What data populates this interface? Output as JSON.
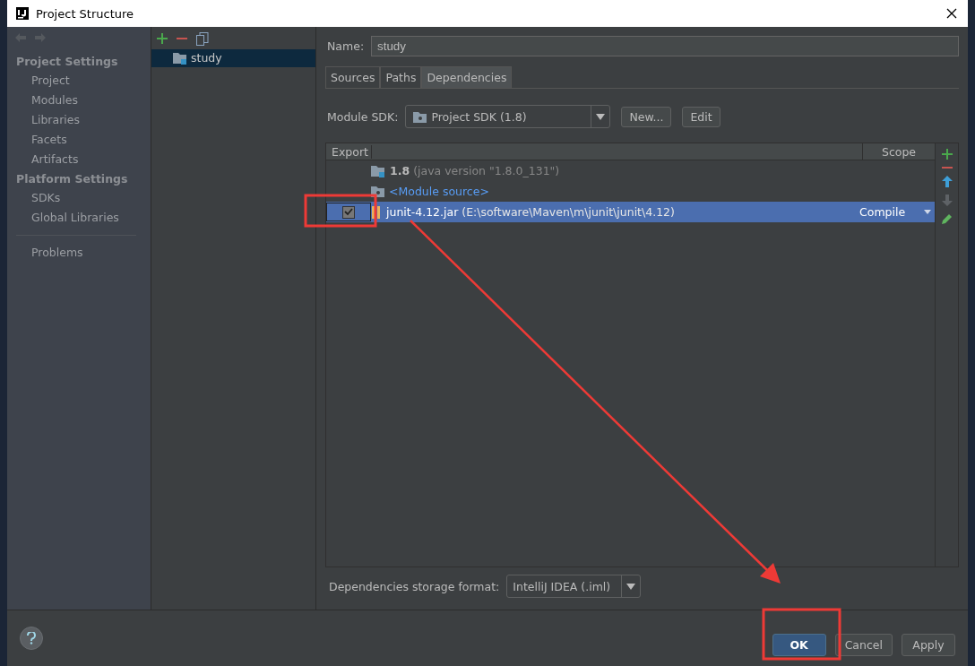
{
  "window": {
    "title": "Project Structure"
  },
  "nav": {
    "sections": [
      {
        "title": "Project Settings",
        "items": [
          {
            "label": "Project",
            "selected": false
          },
          {
            "label": "Modules",
            "selected": false
          },
          {
            "label": "Libraries",
            "selected": false
          },
          {
            "label": "Facets",
            "selected": false
          },
          {
            "label": "Artifacts",
            "selected": false
          }
        ]
      },
      {
        "title": "Platform Settings",
        "items": [
          {
            "label": "SDKs",
            "selected": false
          },
          {
            "label": "Global Libraries",
            "selected": false
          }
        ]
      }
    ],
    "extra_items": [
      {
        "label": "Problems",
        "selected": false
      }
    ]
  },
  "modules": [
    {
      "name": "study",
      "selected": true
    }
  ],
  "name_field": {
    "label": "Name:",
    "value": "study"
  },
  "tabs": [
    {
      "label": "Sources",
      "selected": false
    },
    {
      "label": "Paths",
      "selected": false
    },
    {
      "label": "Dependencies",
      "selected": true
    }
  ],
  "module_sdk": {
    "label": "Module SDK:",
    "value": "Project SDK (1.8)",
    "buttons": [
      "New...",
      "Edit"
    ]
  },
  "table": {
    "columns": [
      "Export",
      "Scope"
    ],
    "rows": [
      {
        "kind": "sdk",
        "name": "1.8",
        "detail": "(java version \"1.8.0_131\")",
        "selected": false
      },
      {
        "kind": "source",
        "name": "<Module source>",
        "selected": false
      },
      {
        "kind": "jar",
        "name": "junit-4.12.jar",
        "detail": "(E:\\software\\Maven\\m\\junit\\junit\\4.12)",
        "scope": "Compile",
        "export": true,
        "selected": true
      }
    ]
  },
  "storage_format": {
    "label": "Dependencies storage format:",
    "value": "IntelliJ IDEA (.iml)"
  },
  "buttons": [
    {
      "label": "OK",
      "kind": "default"
    },
    {
      "label": "Cancel",
      "kind": "normal"
    },
    {
      "label": "Apply",
      "kind": "normal"
    }
  ]
}
